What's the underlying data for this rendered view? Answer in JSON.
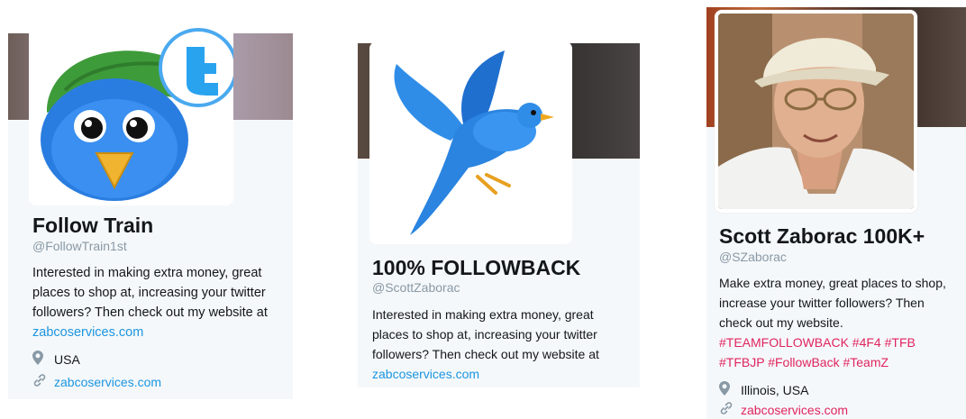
{
  "cards": [
    {
      "name": "Follow Train",
      "handle": "@FollowTrain1st",
      "bio_lines": [
        "Interested in making extra money, great",
        "places to shop at, increasing your twitter",
        "followers? Then check out my website at"
      ],
      "bio_link": "zabcoservices.com",
      "location": "USA",
      "website": "zabcoservices.com",
      "avatar_icon": "cartoon-bird-cap-icon"
    },
    {
      "name": "100% FOLLOWBACK",
      "handle": "@ScottZaborac",
      "bio_lines": [
        "Interested in making extra money, great",
        "places to shop at, increasing your twitter",
        "followers? Then check out my website at"
      ],
      "bio_link": "zabcoservices.com",
      "avatar_icon": "flying-bird-icon"
    },
    {
      "name": "Scott Zaborac 100K+",
      "handle": "@SZaborac",
      "bio_lines": [
        "Make extra money, great places to shop,",
        "increase your twitter followers? Then",
        "check out my website."
      ],
      "hashtags_line1": "#TEAMFOLLOWBACK #4F4 #TFB",
      "hashtags_line2": "#TFBJP #FollowBack #TeamZ",
      "location": "Illinois, USA",
      "website": "zabcoservices.com",
      "avatar_icon": "man-portrait-photo"
    }
  ],
  "colors": {
    "link": "#1b95e0",
    "hashtag": "#e0245e",
    "panel": "#f5f8fa"
  }
}
